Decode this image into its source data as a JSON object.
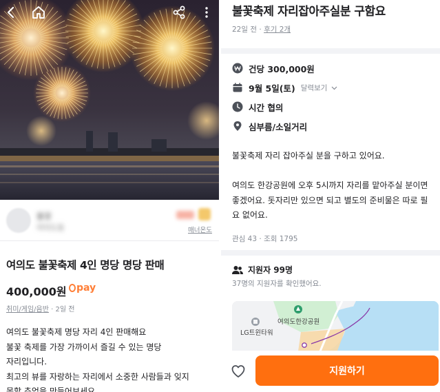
{
  "left": {
    "topbar": {
      "back_icon": "back-arrow-icon",
      "home_icon": "home-icon",
      "share_icon": "share-icon",
      "more_icon": "more-vertical-icon"
    },
    "seller": {
      "name": "불꽃",
      "location": "여의도동",
      "manner_label": "매너온도"
    },
    "title": "여의도 불꽃축제 4인 명당 명당 판매",
    "price": "400,000원",
    "pay_label": "pay",
    "meta": {
      "category": "취미/게임/음반",
      "time": "2일 전"
    },
    "description_lines": [
      "여의도 불꽃축제 명당 자리 4인 판매해요",
      "불꽃 축제를 가장 가까이서 즐길 수 있는 명당",
      "자리입니다.",
      "최고의 뷰를 자랑하는 자리에서 소중한 사람들과 잊지",
      "못할 추억을 만들어보세요"
    ]
  },
  "right": {
    "title": "불꽃축제 자리잡아주실분 구함요",
    "meta": {
      "time": "22일 전",
      "reviews": "후기 2개"
    },
    "info": {
      "pay": "건당 300,000원",
      "date": "9월 5일(토)",
      "calendar_link": "달력보기",
      "time": "시간 협의",
      "location": "심부름/소일거리"
    },
    "description": {
      "p1": "불꽃축제 자리 잡아주실 분을 구하고 있어요.",
      "p2_lines": [
        "여의도 한강공원에 오후 5시까지 자리를 맡아주실 분이면",
        "좋겠어요. 돗자리만 있으면 되고 별도의 준비물은 따로 필",
        "요 없어요."
      ]
    },
    "stats": {
      "interest": "관심 43",
      "views": "조회 1795"
    },
    "applicants": {
      "title": "지원자 99명",
      "sub": "37명의 지원자를 확인했어요."
    },
    "map": {
      "park_label": "여의도한강공원",
      "building_label": "LG트윈타워"
    },
    "apply_button": "지원하기"
  },
  "colors": {
    "accent": "#ff6f0f",
    "gray_text": "#868b94",
    "divider": "#f2f3f6",
    "river": "#b7dff5",
    "park": "#cdeecf"
  }
}
